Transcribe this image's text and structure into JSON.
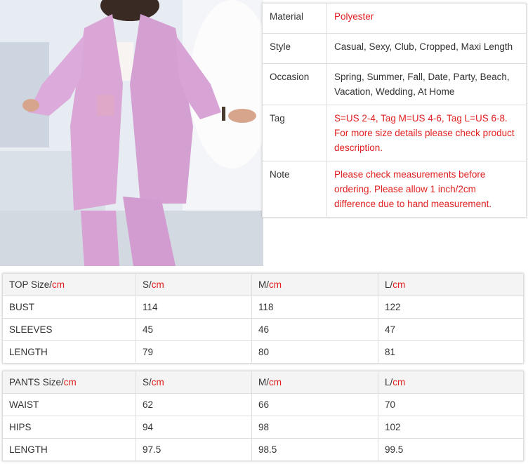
{
  "attributes": [
    {
      "key": "Material",
      "value": "Polyester",
      "highlight": true
    },
    {
      "key": "Style",
      "value": "Casual, Sexy, Club, Cropped, Maxi Length",
      "highlight": false
    },
    {
      "key": "Occasion",
      "value": "Spring, Summer, Fall, Date, Party, Beach, Vacation, Wedding, At Home",
      "highlight": false
    },
    {
      "key": "Tag",
      "value": "S=US 2-4, Tag M=US 4-6, Tag L=US 6-8. For more size details please check product description.",
      "highlight": true
    },
    {
      "key": "Note",
      "value": "Please check measurements before ordering. Please allow 1 inch/2cm difference due to hand measurement.",
      "highlight": true
    }
  ],
  "top_sizes": {
    "header": {
      "label": "TOP Size/",
      "unit": "cm",
      "cols": [
        {
          "label": "S/",
          "unit": "cm"
        },
        {
          "label": "M/",
          "unit": "cm"
        },
        {
          "label": "L/",
          "unit": "cm"
        }
      ]
    },
    "rows": [
      {
        "name": "BUST",
        "values": [
          "114",
          "118",
          "122"
        ]
      },
      {
        "name": "SLEEVES",
        "values": [
          "45",
          "46",
          "47"
        ]
      },
      {
        "name": "LENGTH",
        "values": [
          "79",
          "80",
          "81"
        ]
      }
    ]
  },
  "pants_sizes": {
    "header": {
      "label": "PANTS Size/",
      "unit": "cm",
      "cols": [
        {
          "label": "S/",
          "unit": "cm"
        },
        {
          "label": "M/",
          "unit": "cm"
        },
        {
          "label": "L/",
          "unit": "cm"
        }
      ]
    },
    "rows": [
      {
        "name": "WAIST",
        "values": [
          "62",
          "66",
          "70"
        ]
      },
      {
        "name": "HIPS",
        "values": [
          "94",
          "98",
          "102"
        ]
      },
      {
        "name": "LENGTH",
        "values": [
          "97.5",
          "98.5",
          "99.5"
        ]
      }
    ]
  },
  "colors": {
    "accent_red": "#e02020",
    "garment_pink": "#d9a6d6"
  }
}
